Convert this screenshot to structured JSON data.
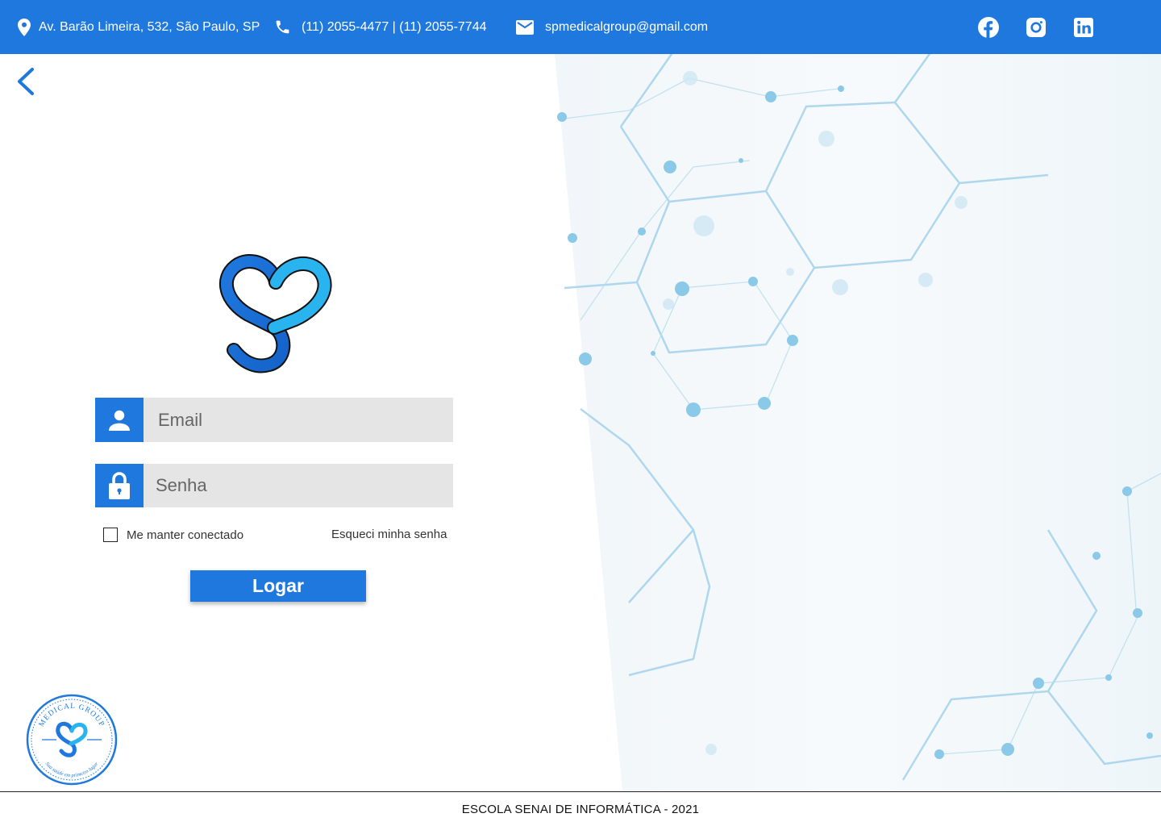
{
  "topbar": {
    "address": "Av. Barão Limeira, 532, São Paulo, SP",
    "phone": "(11) 2055-4477 | (11) 2055-7744",
    "email": "spmedicalgroup@gmail.com",
    "icons": [
      "location-pin-icon",
      "phone-icon",
      "mail-icon",
      "facebook-icon",
      "instagram-icon",
      "linkedin-icon"
    ]
  },
  "login": {
    "email_placeholder": "Email",
    "password_placeholder": "Senha",
    "remember_label": "Me manter conectado",
    "forgot_label": "Esqueci minha senha",
    "submit_label": "Logar"
  },
  "seal": {
    "top_text": "MEDICAL GROUP",
    "bottom_text": "Sua saúde em primeiro lugar"
  },
  "footer": {
    "text": "ESCOLA SENAI DE INFORMÁTICA - 2021"
  },
  "colors": {
    "brand_blue": "#1f78de",
    "logo_light": "#29b4f0",
    "input_bg": "#e5e5e5",
    "bg_network": "#9fcdea"
  }
}
